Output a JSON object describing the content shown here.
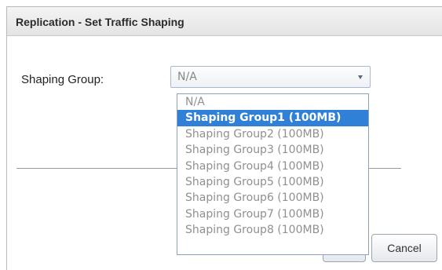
{
  "dialog": {
    "title": "Replication - Set Traffic Shaping"
  },
  "form": {
    "shaping_group_label": "Shaping Group:",
    "shaping_group_value": "N/A"
  },
  "dropdown": {
    "options": [
      "N/A",
      "Shaping Group1 (100MB)",
      "Shaping Group2 (100MB)",
      "Shaping Group3 (100MB)",
      "Shaping Group4 (100MB)",
      "Shaping Group5 (100MB)",
      "Shaping Group6 (100MB)",
      "Shaping Group7 (100MB)",
      "Shaping Group8 (100MB)"
    ],
    "highlighted": "Shaping Group1 (100MB)"
  },
  "buttons": {
    "cancel_label": "Cancel"
  },
  "colors": {
    "highlight": "#2f80d6",
    "title_bar": "#e9e9e9"
  }
}
